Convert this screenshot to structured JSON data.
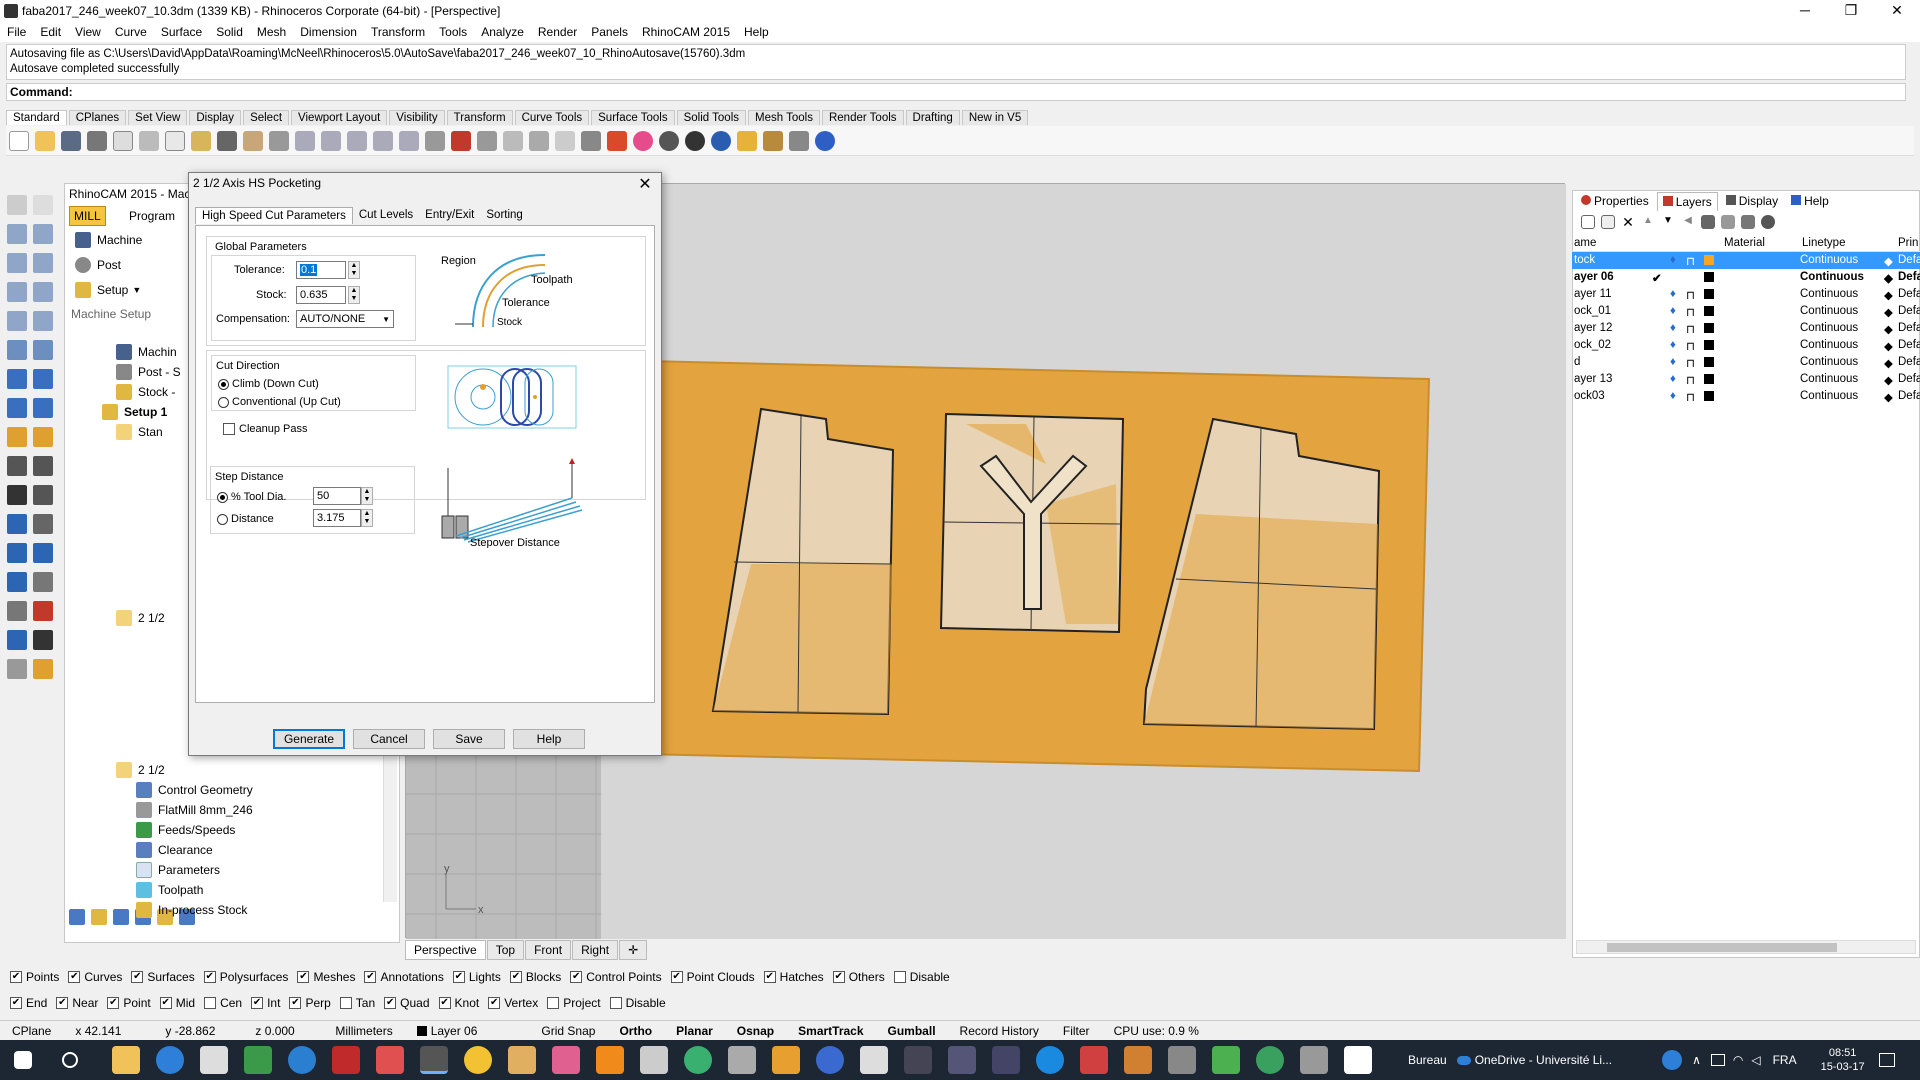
{
  "window": {
    "title": "faba2017_246_week07_10.3dm (1339 KB) - Rhinoceros Corporate (64-bit) - [Perspective]",
    "minimize": "─",
    "maximize": "❐",
    "close": "✕"
  },
  "menu": [
    "File",
    "Edit",
    "View",
    "Curve",
    "Surface",
    "Solid",
    "Mesh",
    "Dimension",
    "Transform",
    "Tools",
    "Analyze",
    "Render",
    "Panels",
    "RhinoCAM 2015",
    "Help"
  ],
  "command_history": {
    "line1": "Autosaving file as C:\\Users\\David\\AppData\\Roaming\\McNeel\\Rhinoceros\\5.0\\AutoSave\\faba2017_246_week07_10_RhinoAutosave(15760).3dm",
    "line2": "Autosave completed successfully"
  },
  "command": {
    "label": "Command:"
  },
  "toolbar_tabs": [
    "Standard",
    "CPlanes",
    "Set View",
    "Display",
    "Select",
    "Viewport Layout",
    "Visibility",
    "Transform",
    "Curve Tools",
    "Surface Tools",
    "Solid Tools",
    "Mesh Tools",
    "Render Tools",
    "Drafting",
    "New in V5"
  ],
  "rhinocam": {
    "title": "RhinoCAM 2015 - Mac",
    "mill": "MILL",
    "program": "Program",
    "machine": "Machine",
    "post": "Post",
    "setup": "Setup",
    "machine_setup": "Machine Setup",
    "tree": [
      "Machin",
      "Post - S",
      "Stock -",
      "Setup 1",
      "Stan",
      "2 1/2",
      "2 1/2"
    ],
    "tree2": [
      "Control Geometry",
      "FlatMill 8mm_246",
      "Feeds/Speeds",
      "Clearance",
      "Parameters",
      "Toolpath",
      "In-process Stock"
    ]
  },
  "dialog": {
    "title": "2 1/2 Axis HS Pocketing",
    "tabs": [
      "High Speed Cut Parameters",
      "Cut Levels",
      "Entry/Exit",
      "Sorting"
    ],
    "global_params": "Global Parameters",
    "tolerance_label": "Tolerance:",
    "tolerance_value": "0.1",
    "stock_label": "Stock:",
    "stock_value": "0.635",
    "compensation_label": "Compensation:",
    "compensation_value": "AUTO/NONE",
    "diagram1": {
      "region": "Region",
      "toolpath": "Toolpath",
      "tolerance": "Tolerance",
      "stock": "Stock"
    },
    "cut_direction": "Cut Direction",
    "climb": "Climb (Down Cut)",
    "conventional": "Conventional (Up Cut)",
    "cleanup": "Cleanup Pass",
    "step_distance": "Step Distance",
    "tool_dia_label": "% Tool Dia.",
    "tool_dia_value": "50",
    "distance_label": "Distance",
    "distance_value": "3.175",
    "stepover_label": "Stepover Distance",
    "buttons": {
      "generate": "Generate",
      "cancel": "Cancel",
      "save": "Save",
      "help": "Help"
    }
  },
  "viewport_tabs": [
    "Perspective",
    "Top",
    "Front",
    "Right"
  ],
  "viewport_axes": {
    "y": "y",
    "x": "x"
  },
  "panel_tabs": [
    "Properties",
    "Layers",
    "Display",
    "Help"
  ],
  "layers": {
    "headers": [
      "ame",
      "Material",
      "Linetype",
      "Prin"
    ],
    "rows": [
      {
        "name": "tock",
        "linetype": "Continuous",
        "print": "Defa",
        "selected": true
      },
      {
        "name": "ayer 06",
        "linetype": "Continuous",
        "print": "Defa",
        "current": true
      },
      {
        "name": "ayer 11",
        "linetype": "Continuous",
        "print": "Defa"
      },
      {
        "name": "ock_01",
        "linetype": "Continuous",
        "print": "Defa"
      },
      {
        "name": "ayer 12",
        "linetype": "Continuous",
        "print": "Defa"
      },
      {
        "name": "ock_02",
        "linetype": "Continuous",
        "print": "Defa"
      },
      {
        "name": "d",
        "linetype": "Continuous",
        "print": "Defa"
      },
      {
        "name": "ayer 13",
        "linetype": "Continuous",
        "print": "Defa"
      },
      {
        "name": "ock03",
        "linetype": "Continuous",
        "print": "Defa"
      }
    ]
  },
  "select_filter": [
    {
      "label": "Points",
      "on": true
    },
    {
      "label": "Curves",
      "on": true
    },
    {
      "label": "Surfaces",
      "on": true
    },
    {
      "label": "Polysurfaces",
      "on": true
    },
    {
      "label": "Meshes",
      "on": true
    },
    {
      "label": "Annotations",
      "on": true
    },
    {
      "label": "Lights",
      "on": true
    },
    {
      "label": "Blocks",
      "on": true
    },
    {
      "label": "Control Points",
      "on": true
    },
    {
      "label": "Point Clouds",
      "on": true
    },
    {
      "label": "Hatches",
      "on": true
    },
    {
      "label": "Others",
      "on": true
    },
    {
      "label": "Disable",
      "on": false
    }
  ],
  "osnap": [
    {
      "label": "End",
      "on": true
    },
    {
      "label": "Near",
      "on": true
    },
    {
      "label": "Point",
      "on": true
    },
    {
      "label": "Mid",
      "on": true
    },
    {
      "label": "Cen",
      "on": false
    },
    {
      "label": "Int",
      "on": true
    },
    {
      "label": "Perp",
      "on": true
    },
    {
      "label": "Tan",
      "on": false
    },
    {
      "label": "Quad",
      "on": true
    },
    {
      "label": "Knot",
      "on": true
    },
    {
      "label": "Vertex",
      "on": true
    },
    {
      "label": "Project",
      "on": false
    },
    {
      "label": "Disable",
      "on": false
    }
  ],
  "status": {
    "cplane": "CPlane",
    "x": "x 42.141",
    "y": "y -28.862",
    "z": "z 0.000",
    "units": "Millimeters",
    "layer": "Layer 06",
    "grid_snap": "Grid Snap",
    "ortho": "Ortho",
    "planar": "Planar",
    "osnap": "Osnap",
    "smarttrack": "SmartTrack",
    "gumball": "Gumball",
    "record_history": "Record History",
    "filter": "Filter",
    "cpu": "CPU use: 0.9 %"
  },
  "taskbar": {
    "bureau": "Bureau",
    "onedrive": "OneDrive - Université Li...",
    "lang": "FRA",
    "time": "08:51",
    "date": "15-03-17"
  },
  "colors": {
    "stock_orange": "#e3a33e",
    "part_beige": "#e8d4b4",
    "accent": "#0078d7"
  }
}
